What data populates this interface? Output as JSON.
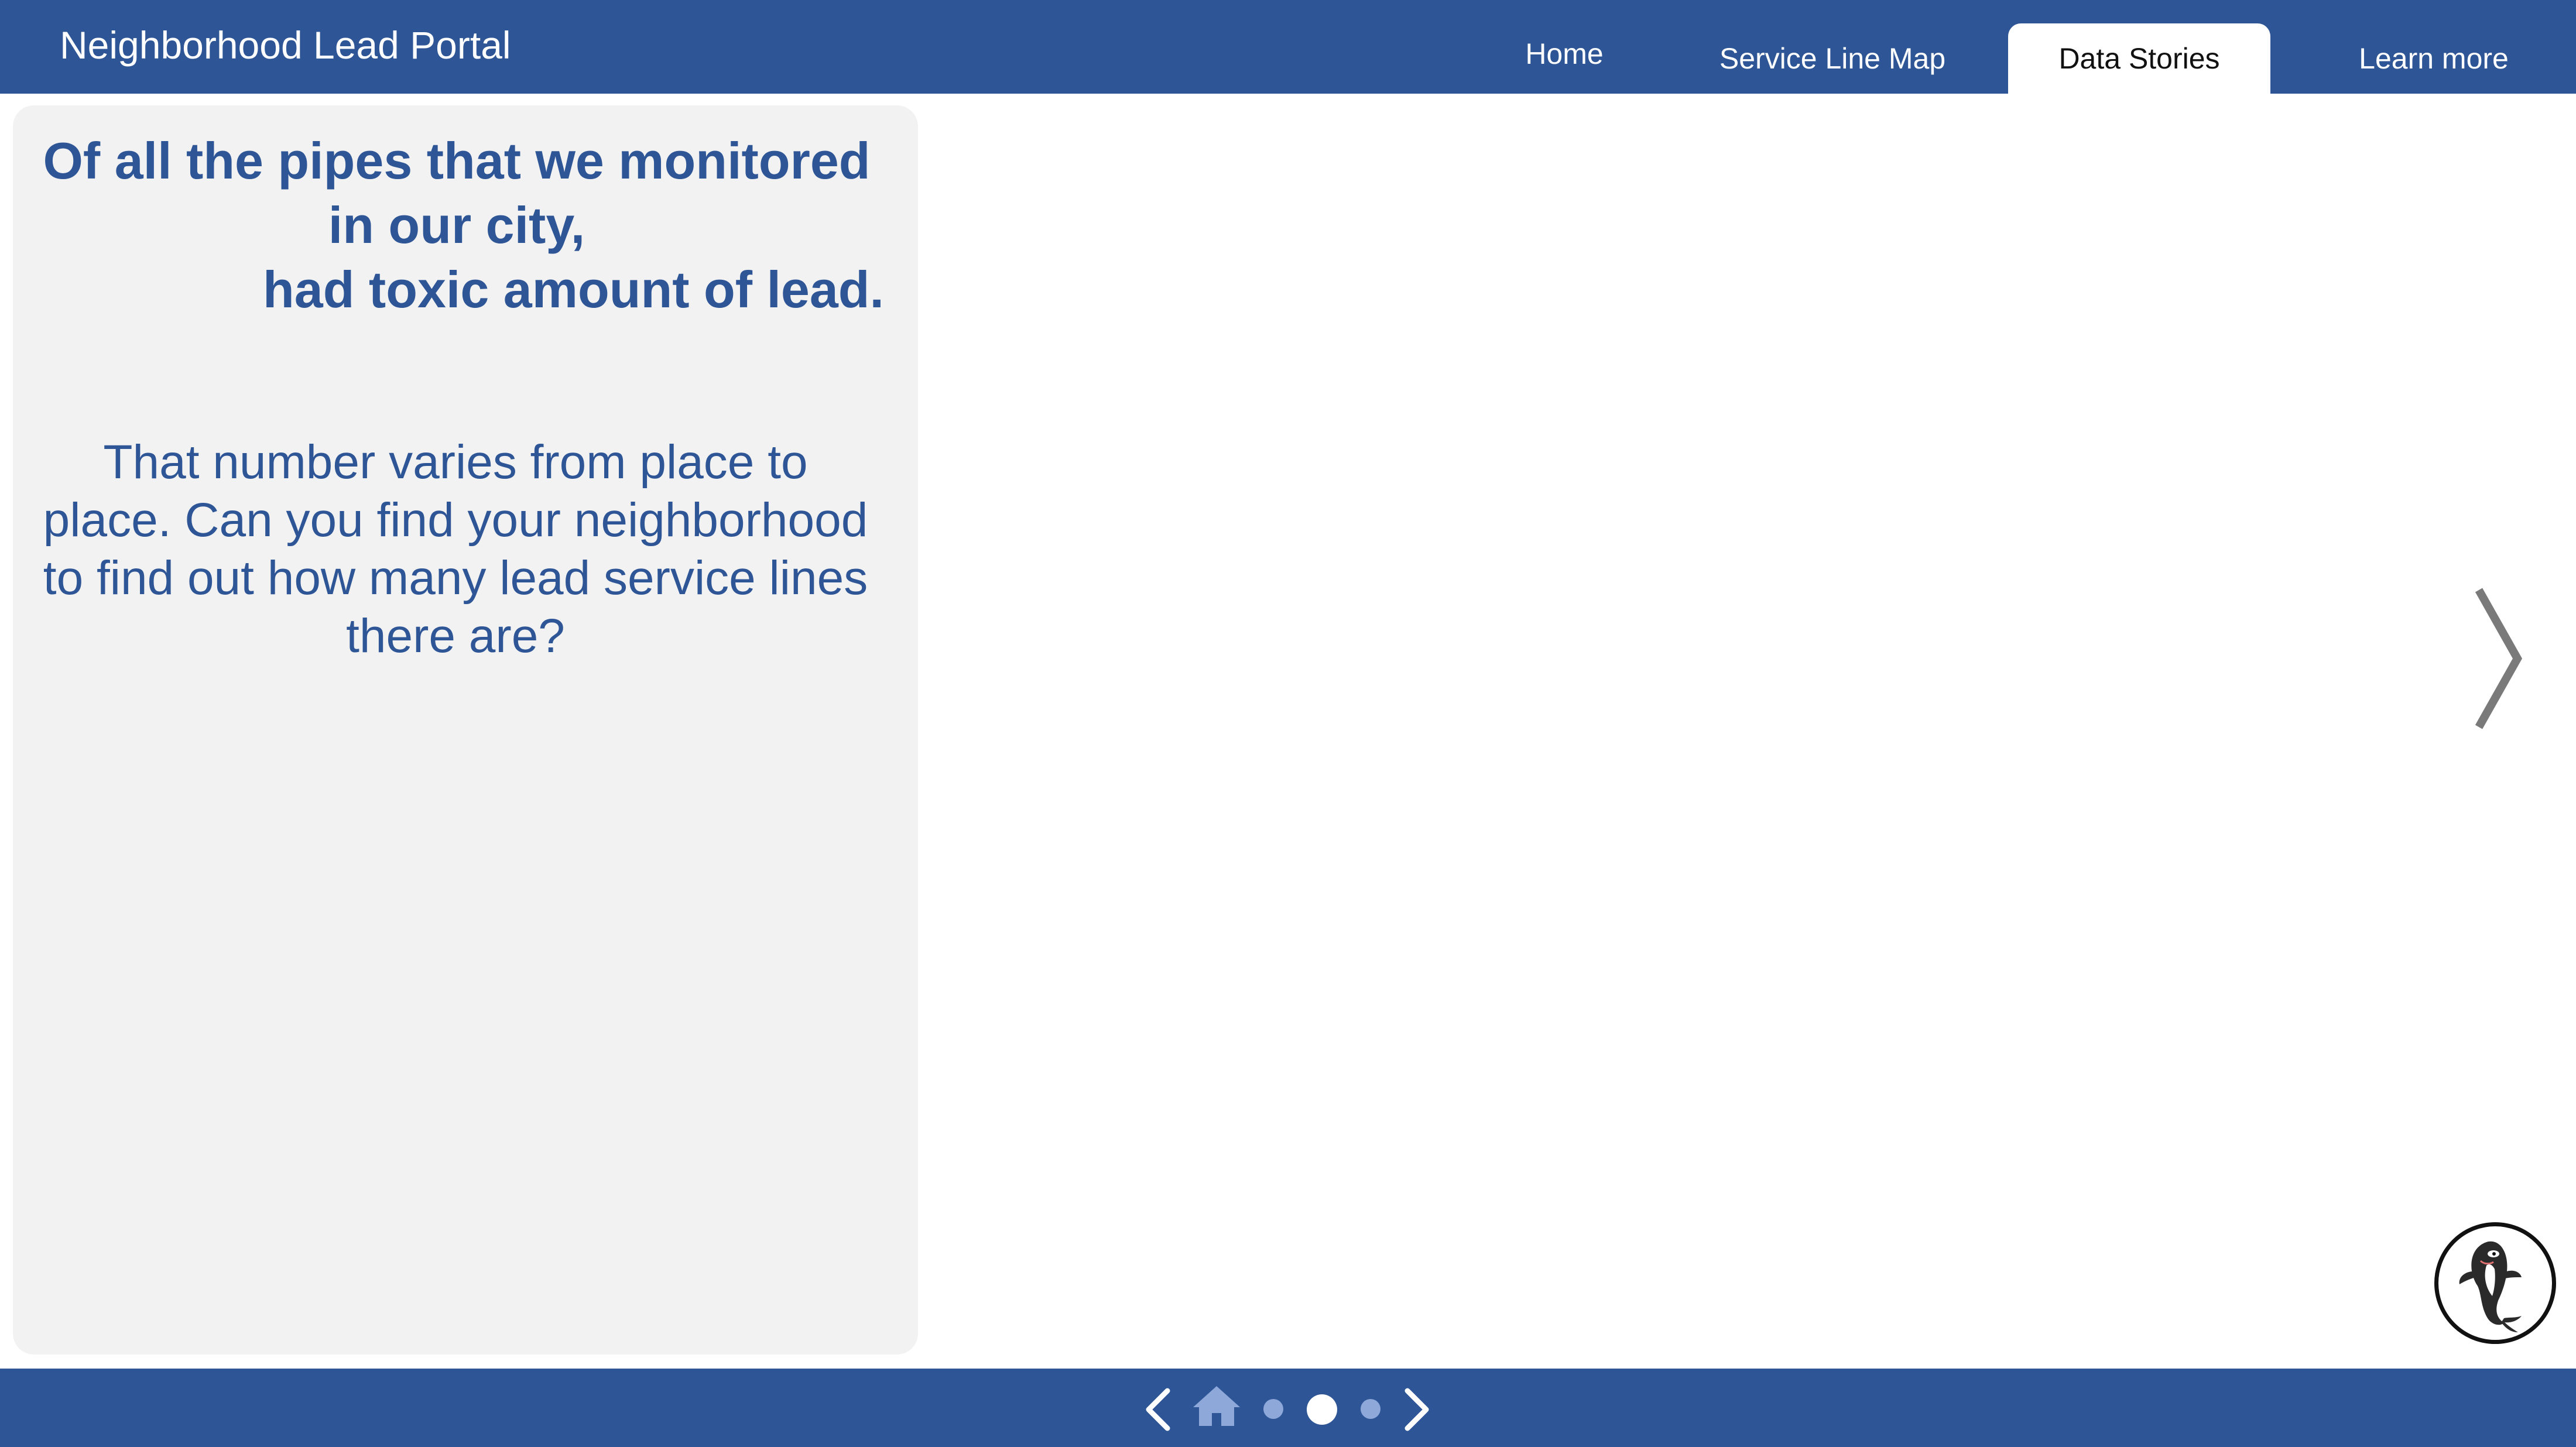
{
  "header": {
    "app_title": "Neighborhood Lead Portal",
    "tabs": [
      {
        "label": "Home",
        "active": false
      },
      {
        "label": "Service Line Map",
        "active": false
      },
      {
        "label": "Data Stories",
        "active": true
      },
      {
        "label": "Learn more",
        "active": false
      }
    ]
  },
  "panel": {
    "headline_lines": [
      "Of all the pipes that we monitored",
      "in our city,",
      "had toxic amount of lead."
    ],
    "body_lines": [
      "That number varies from place to",
      "place. Can you find your neighborhood",
      "to find out how many lead service lines",
      "there are?"
    ]
  },
  "story_nav": {
    "total_slides": 3,
    "current_slide": 2
  },
  "icons": {
    "next_slide": "chevron-right-icon",
    "footer_prev": "chevron-left-icon",
    "footer_home": "home-icon",
    "footer_next": "chevron-right-icon",
    "mascot": "orca-mascot-icon"
  },
  "colors": {
    "brand_blue": "#2e5596",
    "panel_bg": "#f2f2f2",
    "inactive_dot": "#8fa8da",
    "home_icon": "#8fa8da",
    "arrow_gray": "#7a7a7a"
  }
}
